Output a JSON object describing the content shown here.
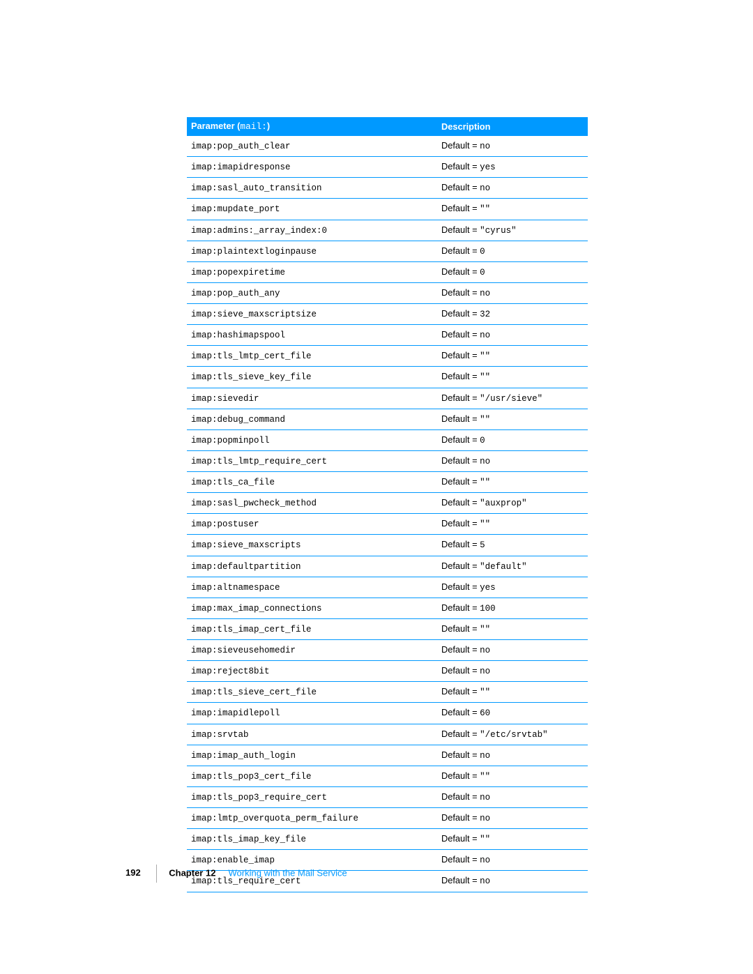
{
  "table": {
    "header": {
      "paramLabel": "Parameter (",
      "paramMono": "mail:",
      "paramClose": ")",
      "descLabel": "Description"
    },
    "defaultPrefix": "Default = ",
    "rows": [
      {
        "param": "imap:pop_auth_clear",
        "value": "no"
      },
      {
        "param": "imap:imapidresponse",
        "value": "yes"
      },
      {
        "param": "imap:sasl_auto_transition",
        "value": "no"
      },
      {
        "param": "imap:mupdate_port",
        "value": "\"\""
      },
      {
        "param": "imap:admins:_array_index:0",
        "value": "\"cyrus\""
      },
      {
        "param": "imap:plaintextloginpause",
        "value": "0"
      },
      {
        "param": "imap:popexpiretime",
        "value": "0"
      },
      {
        "param": "imap:pop_auth_any",
        "value": "no"
      },
      {
        "param": "imap:sieve_maxscriptsize",
        "value": "32"
      },
      {
        "param": "imap:hashimapspool",
        "value": "no"
      },
      {
        "param": "imap:tls_lmtp_cert_file",
        "value": "\"\""
      },
      {
        "param": "imap:tls_sieve_key_file",
        "value": "\"\""
      },
      {
        "param": "imap:sievedir",
        "value": "\"/usr/sieve\""
      },
      {
        "param": "imap:debug_command",
        "value": "\"\""
      },
      {
        "param": "imap:popminpoll",
        "value": "0"
      },
      {
        "param": "imap:tls_lmtp_require_cert",
        "value": "no"
      },
      {
        "param": "imap:tls_ca_file",
        "value": "\"\""
      },
      {
        "param": "imap:sasl_pwcheck_method",
        "value": "\"auxprop\""
      },
      {
        "param": "imap:postuser",
        "value": "\"\""
      },
      {
        "param": "imap:sieve_maxscripts",
        "value": "5"
      },
      {
        "param": "imap:defaultpartition",
        "value": "\"default\""
      },
      {
        "param": "imap:altnamespace",
        "value": "yes"
      },
      {
        "param": "imap:max_imap_connections",
        "value": "100"
      },
      {
        "param": "imap:tls_imap_cert_file",
        "value": "\"\""
      },
      {
        "param": "imap:sieveusehomedir",
        "value": "no"
      },
      {
        "param": "imap:reject8bit",
        "value": "no"
      },
      {
        "param": "imap:tls_sieve_cert_file",
        "value": "\"\""
      },
      {
        "param": "imap:imapidlepoll",
        "value": "60"
      },
      {
        "param": "imap:srvtab",
        "value": "\"/etc/srvtab\""
      },
      {
        "param": "imap:imap_auth_login",
        "value": "no"
      },
      {
        "param": "imap:tls_pop3_cert_file",
        "value": "\"\""
      },
      {
        "param": "imap:tls_pop3_require_cert",
        "value": "no"
      },
      {
        "param": "imap:lmtp_overquota_perm_failure",
        "value": "no"
      },
      {
        "param": "imap:tls_imap_key_file",
        "value": "\"\""
      },
      {
        "param": "imap:enable_imap",
        "value": "no"
      },
      {
        "param": "imap:tls_require_cert",
        "value": "no"
      }
    ]
  },
  "footer": {
    "pageNumber": "192",
    "chapterLabel": "Chapter 12",
    "chapterTitle": "Working with the Mail Service"
  }
}
